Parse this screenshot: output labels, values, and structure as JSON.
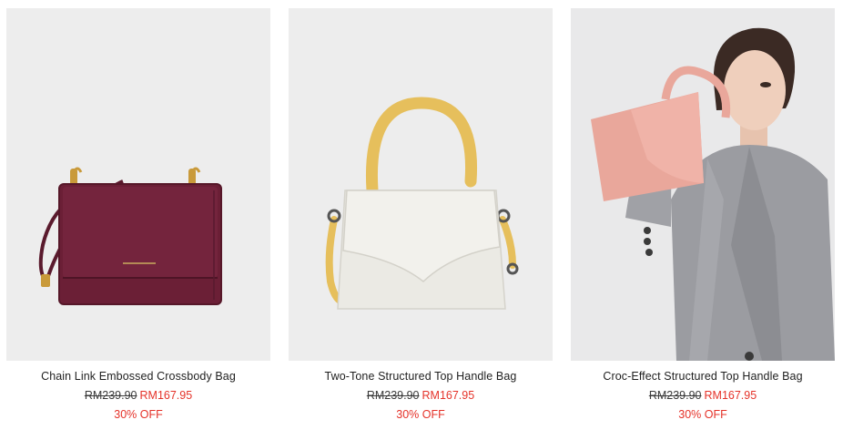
{
  "products": [
    {
      "title": "Chain Link Embossed Crossbody Bag",
      "original_price": "RM239.90",
      "sale_price": "RM167.95",
      "discount": "30% OFF",
      "bag_color": "#6b1f36"
    },
    {
      "title": "Two-Tone Structured Top Handle Bag",
      "original_price": "RM239.90",
      "sale_price": "RM167.95",
      "discount": "30% OFF",
      "bag_color": "#ebeae4",
      "handle_color": "#e6bf5c"
    },
    {
      "title": "Croc-Effect Structured Top Handle Bag",
      "original_price": "RM239.90",
      "sale_price": "RM167.95",
      "discount": "30% OFF",
      "bag_color": "#e9a79b"
    }
  ],
  "colors": {
    "sale": "#e5332a",
    "text": "#1f1f1f",
    "image_bg": "#ededed"
  }
}
